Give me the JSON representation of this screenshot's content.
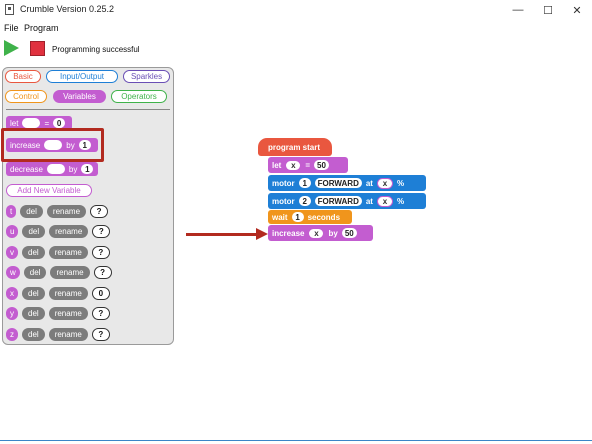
{
  "window": {
    "title": "Crumble Version 0.25.2",
    "minimize": "—",
    "maximize": "☐",
    "close": "✕"
  },
  "menu": {
    "file": "File",
    "program": "Program"
  },
  "toolbar": {
    "status": "Programming successful"
  },
  "palette": {
    "categories": [
      "Basic",
      "Input/Output",
      "Sparkles",
      "Control",
      "Variables",
      "Operators"
    ],
    "let_block": {
      "label": "let",
      "eq": "=",
      "value": "0"
    },
    "increase_block": {
      "label": "increase",
      "by": "by",
      "value": "1"
    },
    "decrease_block": {
      "label": "decrease",
      "by": "by",
      "value": "1"
    },
    "add_variable": "Add New Variable",
    "variables": [
      {
        "name": "t",
        "del": "del",
        "rename": "rename",
        "value": "?"
      },
      {
        "name": "u",
        "del": "del",
        "rename": "rename",
        "value": "?"
      },
      {
        "name": "v",
        "del": "del",
        "rename": "rename",
        "value": "?"
      },
      {
        "name": "w",
        "del": "del",
        "rename": "rename",
        "value": "?"
      },
      {
        "name": "x",
        "del": "del",
        "rename": "rename",
        "value": "0"
      },
      {
        "name": "y",
        "del": "del",
        "rename": "rename",
        "value": "?"
      },
      {
        "name": "z",
        "del": "del",
        "rename": "rename",
        "value": "?"
      }
    ]
  },
  "program": {
    "start": "program start",
    "let": {
      "label": "let",
      "var": "x",
      "eq": "=",
      "value": "50"
    },
    "motor1": {
      "label": "motor",
      "num": "1",
      "dir": "FORWARD",
      "at": "at",
      "var": "x",
      "pct": "%"
    },
    "motor2": {
      "label": "motor",
      "num": "2",
      "dir": "FORWARD",
      "at": "at",
      "var": "x",
      "pct": "%"
    },
    "wait": {
      "label": "wait",
      "value": "1",
      "unit": "seconds"
    },
    "increase": {
      "label": "increase",
      "var": "x",
      "by": "by",
      "value": "50"
    }
  },
  "colors": {
    "variables": "#c35dd0",
    "motor": "#1e7fd6",
    "control": "#f0951c",
    "start": "#e9573f",
    "highlight": "#b22a1f"
  }
}
